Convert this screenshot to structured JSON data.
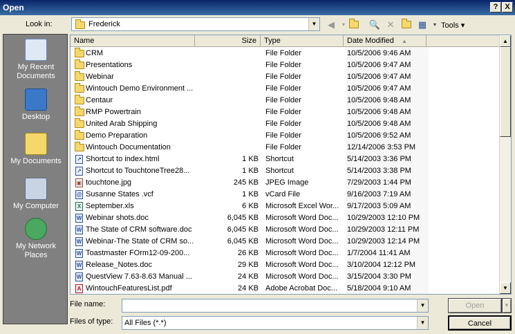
{
  "window": {
    "title": "Open",
    "help_label": "?",
    "close_label": "X"
  },
  "lookin": {
    "label": "Look in:",
    "value": "Frederick"
  },
  "toolbar": {
    "tools_label": "Tools"
  },
  "places": [
    {
      "label": "My Recent Documents",
      "icon": "recent-documents-icon"
    },
    {
      "label": "Desktop",
      "icon": "desktop-icon"
    },
    {
      "label": "My Documents",
      "icon": "my-documents-icon"
    },
    {
      "label": "My Computer",
      "icon": "my-computer-icon"
    },
    {
      "label": "My Network Places",
      "icon": "network-places-icon"
    }
  ],
  "columns": {
    "name": "Name",
    "size": "Size",
    "type": "Type",
    "date": "Date Modified"
  },
  "files": [
    {
      "name": "CRM",
      "size": "",
      "type": "File Folder",
      "date": "10/5/2006 9:46 AM",
      "icon": "folder"
    },
    {
      "name": "Presentations",
      "size": "",
      "type": "File Folder",
      "date": "10/5/2006 9:47 AM",
      "icon": "folder"
    },
    {
      "name": "Webinar",
      "size": "",
      "type": "File Folder",
      "date": "10/5/2006 9:47 AM",
      "icon": "folder"
    },
    {
      "name": "Wintouch Demo Environment ...",
      "size": "",
      "type": "File Folder",
      "date": "10/5/2006 9:47 AM",
      "icon": "folder"
    },
    {
      "name": "Centaur",
      "size": "",
      "type": "File Folder",
      "date": "10/5/2006 9:48 AM",
      "icon": "folder"
    },
    {
      "name": "RMP Powertrain",
      "size": "",
      "type": "File Folder",
      "date": "10/5/2006 9:48 AM",
      "icon": "folder"
    },
    {
      "name": "United Arab Shipping",
      "size": "",
      "type": "File Folder",
      "date": "10/5/2006 9:48 AM",
      "icon": "folder"
    },
    {
      "name": "Demo Preparation",
      "size": "",
      "type": "File Folder",
      "date": "10/5/2006 9:52 AM",
      "icon": "folder"
    },
    {
      "name": "Wintouch Documentation",
      "size": "",
      "type": "File Folder",
      "date": "12/14/2006 3:53 PM",
      "icon": "folder"
    },
    {
      "name": "Shortcut to index.html",
      "size": "1 KB",
      "type": "Shortcut",
      "date": "5/14/2003 3:36 PM",
      "icon": "shortcut"
    },
    {
      "name": "Shortcut to TouchtoneTree28...",
      "size": "1 KB",
      "type": "Shortcut",
      "date": "5/14/2003 3:38 PM",
      "icon": "shortcut"
    },
    {
      "name": "touchtone.jpg",
      "size": "245 KB",
      "type": "JPEG Image",
      "date": "7/29/2003 1:44 PM",
      "icon": "image"
    },
    {
      "name": "Susanne States .vcf",
      "size": "1 KB",
      "type": "vCard File",
      "date": "9/16/2003 7:19 AM",
      "icon": "vcard"
    },
    {
      "name": "September.xls",
      "size": "6 KB",
      "type": "Microsoft Excel Wor...",
      "date": "9/17/2003 5:09 AM",
      "icon": "excel"
    },
    {
      "name": "Webinar shots.doc",
      "size": "6,045 KB",
      "type": "Microsoft Word Doc...",
      "date": "10/29/2003 12:10 PM",
      "icon": "word"
    },
    {
      "name": "The State of CRM software.doc",
      "size": "6,045 KB",
      "type": "Microsoft Word Doc...",
      "date": "10/29/2003 12:11 PM",
      "icon": "word"
    },
    {
      "name": "Webinar-The State of CRM so...",
      "size": "6,045 KB",
      "type": "Microsoft Word Doc...",
      "date": "10/29/2003 12:14 PM",
      "icon": "word"
    },
    {
      "name": "Toastmaster FOrm12-09-200...",
      "size": "26 KB",
      "type": "Microsoft Word Doc...",
      "date": "1/7/2004 11:41 AM",
      "icon": "word"
    },
    {
      "name": "Release_Notes.doc",
      "size": "29 KB",
      "type": "Microsoft Word Doc...",
      "date": "3/10/2004 12:12 PM",
      "icon": "word"
    },
    {
      "name": "QuestView 7.63-8.63 Manual ...",
      "size": "24 KB",
      "type": "Microsoft Word Doc...",
      "date": "3/15/2004 3:30 PM",
      "icon": "word"
    },
    {
      "name": "WintouchFeaturesList.pdf",
      "size": "24 KB",
      "type": "Adobe Acrobat Doc...",
      "date": "5/18/2004 9:10 AM",
      "icon": "pdf"
    }
  ],
  "filename": {
    "label": "File name:",
    "value": ""
  },
  "filetype": {
    "label": "Files of type:",
    "value": "All Files (*.*)"
  },
  "buttons": {
    "open": "Open",
    "cancel": "Cancel"
  }
}
